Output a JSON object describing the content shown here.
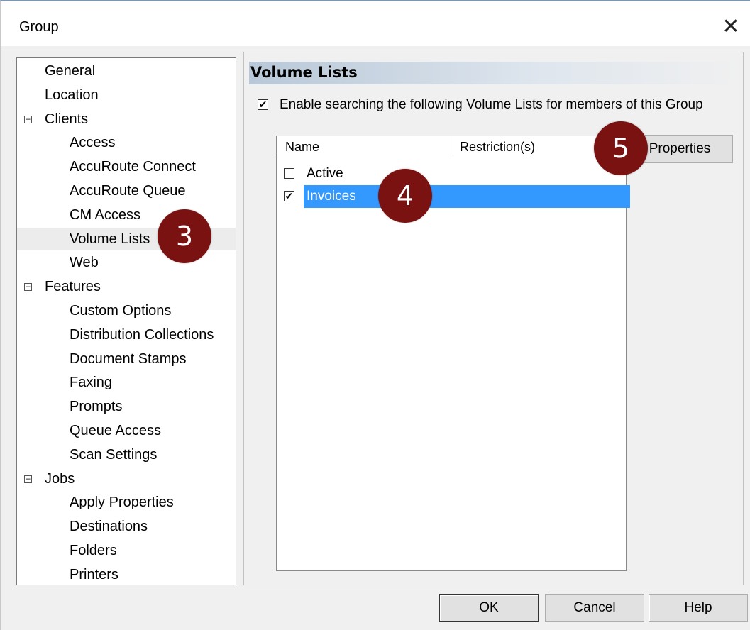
{
  "window": {
    "title": "Group",
    "close_glyph": "✕"
  },
  "tree": {
    "items": [
      {
        "label": "General",
        "level": 0
      },
      {
        "label": "Location",
        "level": 0
      },
      {
        "label": "Clients",
        "level": 0,
        "expander": "−"
      },
      {
        "label": "Access",
        "level": 1
      },
      {
        "label": "AccuRoute Connect",
        "level": 1
      },
      {
        "label": "AccuRoute Queue",
        "level": 1
      },
      {
        "label": "CM Access",
        "level": 1
      },
      {
        "label": "Volume Lists",
        "level": 1,
        "selected": true
      },
      {
        "label": "Web",
        "level": 1
      },
      {
        "label": "Features",
        "level": 0,
        "expander": "−"
      },
      {
        "label": "Custom Options",
        "level": 1
      },
      {
        "label": "Distribution Collections",
        "level": 1
      },
      {
        "label": "Document Stamps",
        "level": 1
      },
      {
        "label": "Faxing",
        "level": 1
      },
      {
        "label": "Prompts",
        "level": 1
      },
      {
        "label": "Queue Access",
        "level": 1
      },
      {
        "label": "Scan Settings",
        "level": 1
      },
      {
        "label": "Jobs",
        "level": 0,
        "expander": "−"
      },
      {
        "label": "Apply Properties",
        "level": 1
      },
      {
        "label": "Destinations",
        "level": 1
      },
      {
        "label": "Folders",
        "level": 1
      },
      {
        "label": "Printers",
        "level": 1
      }
    ]
  },
  "section": {
    "title": "Volume Lists"
  },
  "enable": {
    "label": "Enable searching the following Volume Lists for members of this Group",
    "checked": true,
    "check_glyph": "✔"
  },
  "list": {
    "columns": [
      "Name",
      "Restriction(s)"
    ],
    "rows": [
      {
        "name": "Active",
        "checked": false
      },
      {
        "name": "Invoices",
        "checked": true,
        "selected": true
      }
    ]
  },
  "buttons": {
    "properties": "Properties",
    "ok": "OK",
    "cancel": "Cancel",
    "help": "Help"
  },
  "callouts": [
    "3",
    "4",
    "5"
  ],
  "colors": {
    "callout": "#7a1212",
    "selection": "#3399ff"
  }
}
